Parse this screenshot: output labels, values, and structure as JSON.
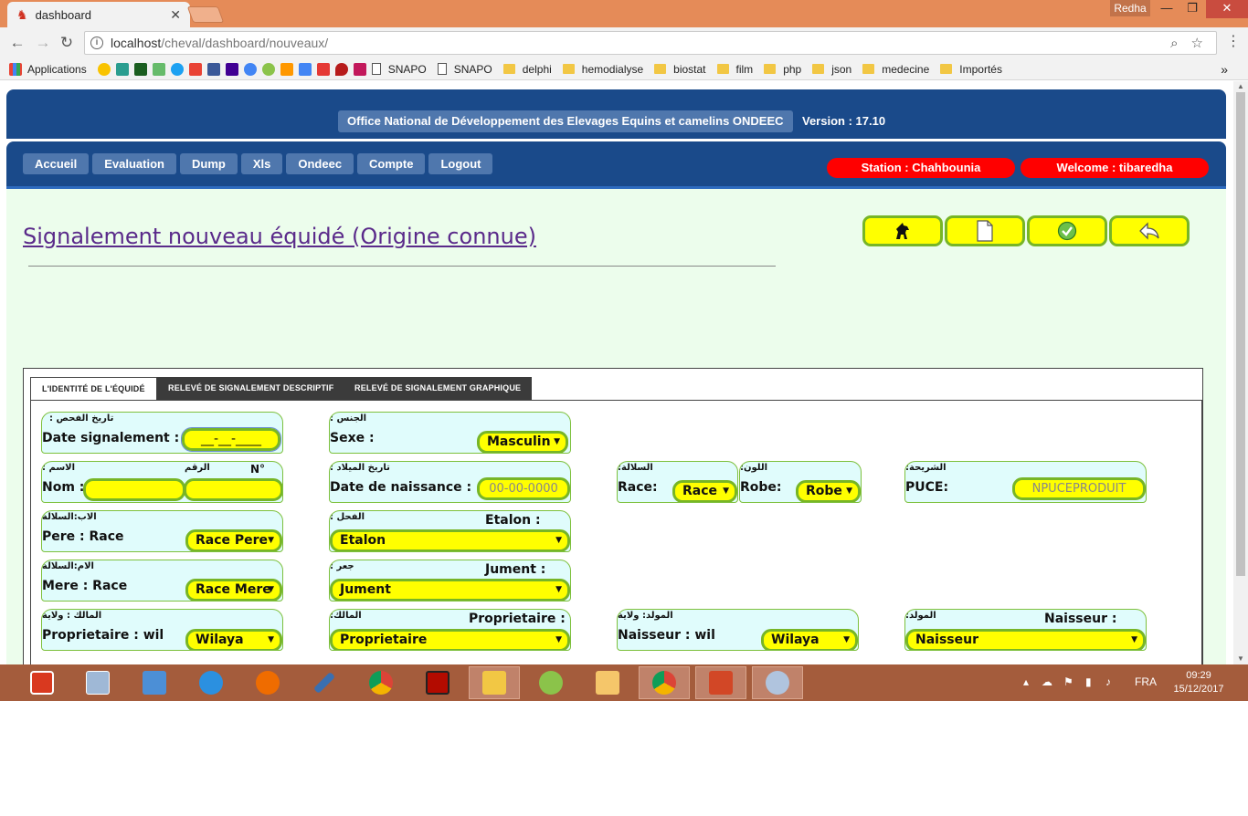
{
  "browser": {
    "tab_title": "dashboard",
    "url_host": "localhost",
    "url_path": "/cheval/dashboard/nouveaux/",
    "user": "Redha",
    "bookmarks": {
      "apps": "Applications",
      "snapo1": "SNAPO",
      "snapo2": "SNAPO",
      "delphi": "delphi",
      "hemodialyse": "hemodialyse",
      "biostat": "biostat",
      "film": "film",
      "php": "php",
      "json": "json",
      "medecine": "medecine",
      "importes": "Importés"
    }
  },
  "header": {
    "org": "Office National de Développement des Elevages Equins et camelins ONDEEC",
    "version": "Version : 17.10"
  },
  "nav": {
    "accueil": "Accueil",
    "evaluation": "Evaluation",
    "dump": "Dump",
    "xls": "Xls",
    "ondeec": "Ondeec",
    "compte": "Compte",
    "logout": "Logout",
    "station": "Station : Chahbounia",
    "welcome": "Welcome : tibaredha"
  },
  "page": {
    "title": "Signalement nouveau équidé (Origine connue)"
  },
  "tabs": {
    "identite": "L'identité de l'équidé",
    "descriptif": "Relevé de signalement descriptif",
    "graphique": "Relevé de signalement graphique"
  },
  "form": {
    "date_signalement": {
      "ar": ": تاريخ الفحص",
      "label": "Date signalement :",
      "value": "__-__-____"
    },
    "sexe": {
      "ar": ": الجنس",
      "label": "Sexe :",
      "value": "Masculin"
    },
    "nom": {
      "ar": ": الاسم",
      "ar2": "الرقم",
      "num": "N°",
      "label": "Nom :"
    },
    "naissance": {
      "ar": ": تاريخ الميلاد",
      "label": "Date de naissance :",
      "value": "00-00-0000"
    },
    "race": {
      "ar": ":السلالة",
      "label": "Race:",
      "value": "Race"
    },
    "robe": {
      "ar": ":اللون",
      "label": "Robe:",
      "value": "Robe"
    },
    "puce": {
      "ar": ":الشريحة",
      "label": "PUCE:",
      "value": "NPUCEPRODUIT"
    },
    "pere": {
      "ar": "الاب:السلالة",
      "label": "Pere : Race",
      "value": "Race Pere"
    },
    "etalon": {
      "ar": ": الفحل",
      "label": "Etalon :",
      "value": "Etalon"
    },
    "mere": {
      "ar": "الام:السلالة",
      "label": "Mere : Race",
      "value": "Race Mere"
    },
    "jument": {
      "ar": ": جعر",
      "label": "Jument :",
      "value": "Jument"
    },
    "prop_wil": {
      "ar": "المالك : ولاية",
      "label": "Proprietaire : wil",
      "value": "Wilaya"
    },
    "proprietaire": {
      "ar": ":المالك",
      "label": "Proprietaire :",
      "value": "Proprietaire"
    },
    "naiss_wil": {
      "ar": "المولد: ولاية",
      "label": "Naisseur : wil",
      "value": "Wilaya"
    },
    "naisseur": {
      "ar": ":المولد",
      "label": "Naisseur :",
      "value": "Naisseur"
    }
  },
  "taskbar": {
    "lang": "FRA",
    "time": "09:29",
    "date": "15/12/2017"
  }
}
